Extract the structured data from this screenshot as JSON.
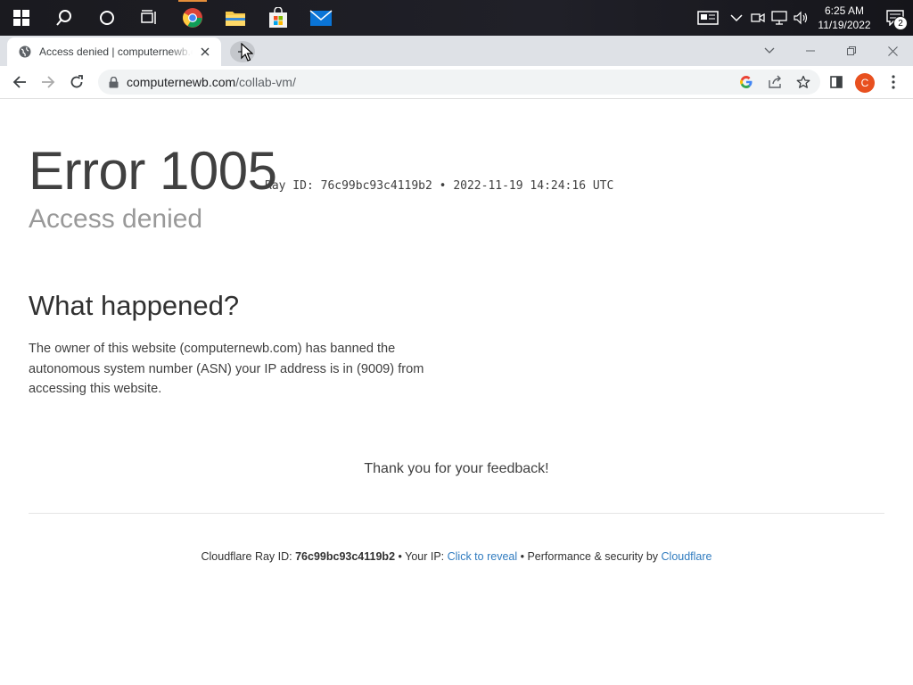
{
  "taskbar": {
    "time": "6:25 AM",
    "date": "11/19/2022",
    "notification_count": "2",
    "pinned": [
      "windows-start",
      "search",
      "cortana",
      "task-view",
      "chrome",
      "file-explorer",
      "microsoft-store",
      "mail"
    ]
  },
  "browser": {
    "tab_title": "Access denied | computernewb.com",
    "url_domain": "computernewb.com",
    "url_path": "/collab-vm/",
    "profile_initial": "C"
  },
  "page": {
    "error_title": "Error 1005",
    "ray_line": "Ray ID: 76c99bc93c4119b2 • 2022-11-19 14:24:16 UTC",
    "subtitle": "Access denied",
    "what_heading": "What happened?",
    "explanation": "The owner of this website (computernewb.com) has banned the autonomous system number (ASN) your IP address is in (9009) from accessing this website.",
    "thanks": "Thank you for your feedback!",
    "footer": {
      "ray_prefix": "Cloudflare Ray ID: ",
      "ray_id": "76c99bc93c4119b2",
      "ip_prefix": " • Your IP: ",
      "ip_link": "Click to reveal",
      "perf_prefix": " • Performance & security by ",
      "perf_link": "Cloudflare"
    }
  },
  "colors": {
    "taskbar": "#1a1a1f",
    "tabstrip": "#dee1e6",
    "link": "#2f7bbf",
    "avatar": "#e8501f"
  }
}
